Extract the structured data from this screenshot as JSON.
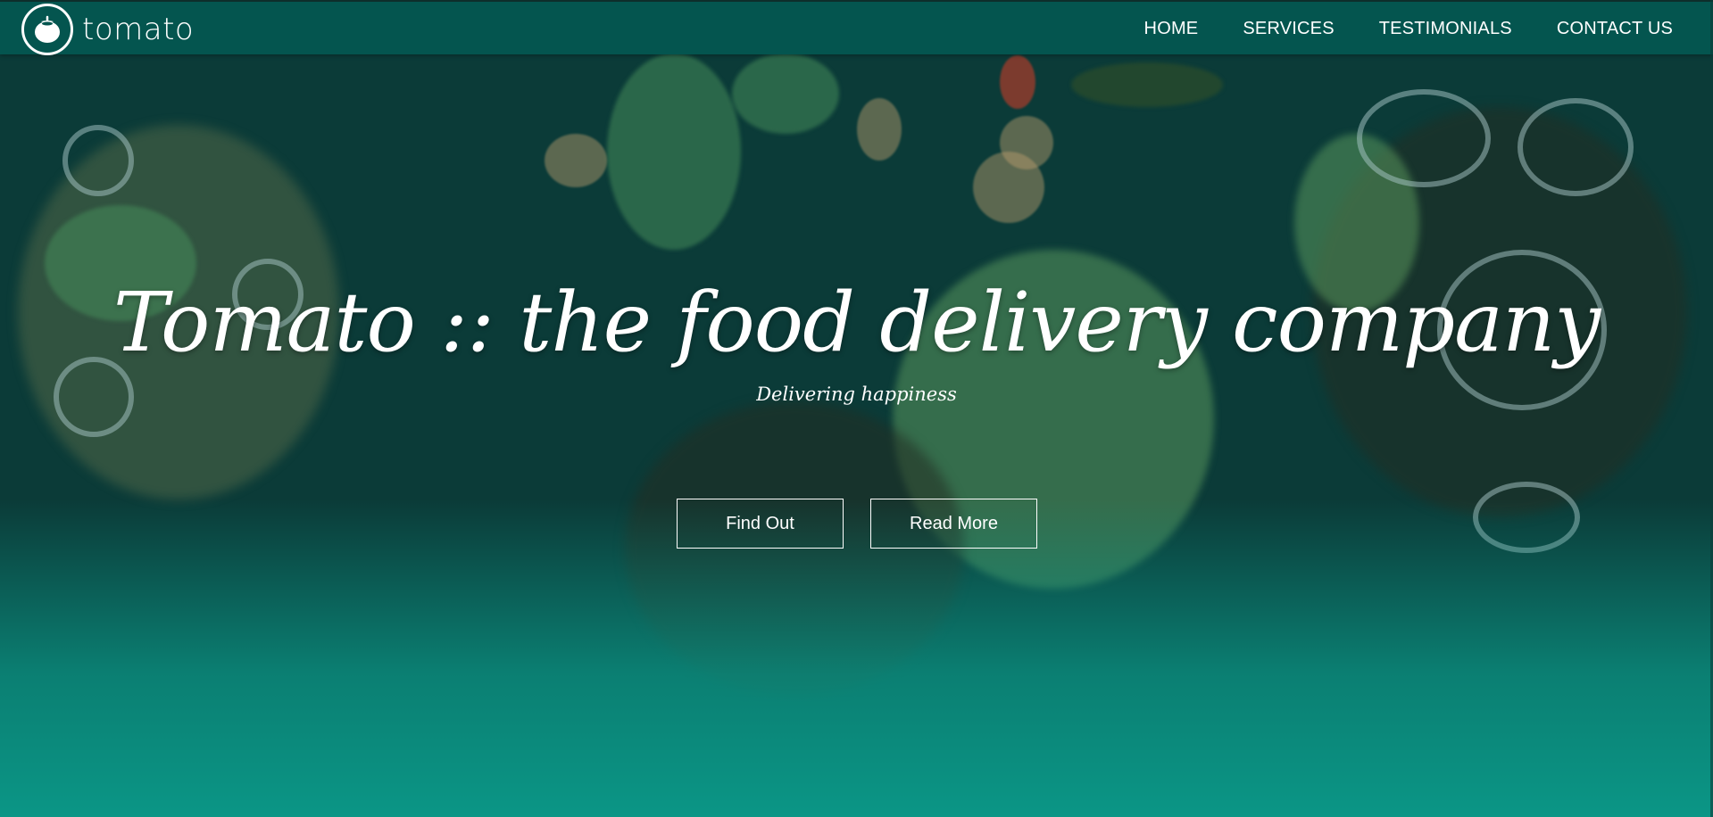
{
  "brand": {
    "name": "tomato",
    "logo_icon": "tomato-icon"
  },
  "nav": {
    "items": [
      {
        "label": "HOME"
      },
      {
        "label": "SERVICES"
      },
      {
        "label": "TESTIMONIALS"
      },
      {
        "label": "CONTACT US"
      }
    ]
  },
  "hero": {
    "title": "Tomato :: the food delivery company",
    "subtitle": "Delivering happiness",
    "buttons": {
      "find_out": "Find Out",
      "read_more": "Read More"
    }
  },
  "colors": {
    "navbar": "#04554f",
    "accent_teal": "#0b9686",
    "text": "#ffffff"
  }
}
